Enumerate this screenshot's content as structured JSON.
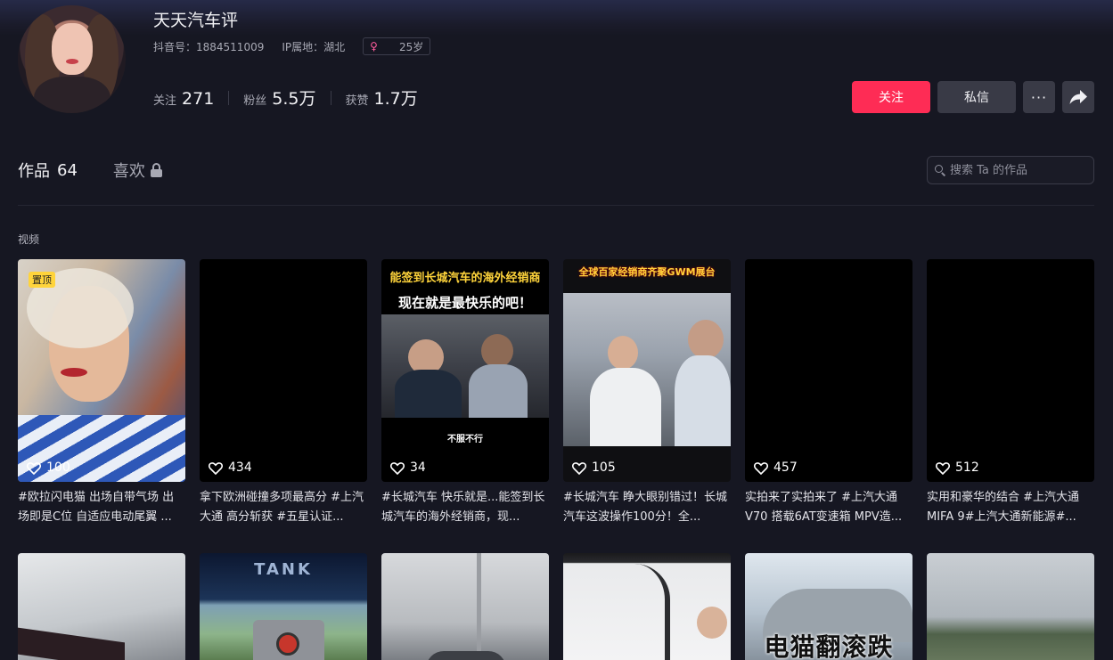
{
  "profile": {
    "name": "天天汽车评",
    "douyin_id": "抖音号：1884511009",
    "ip_location": "IP属地：湖北",
    "age": "25岁",
    "stats": [
      {
        "label": "关注",
        "value": "271"
      },
      {
        "label": "粉丝",
        "value": "5.5万"
      },
      {
        "label": "获赞",
        "value": "1.7万"
      }
    ]
  },
  "actions": {
    "follow": "关注",
    "message": "私信",
    "more": "···"
  },
  "tabs": {
    "works_label": "作品",
    "works_count": "64",
    "likes_label": "喜欢"
  },
  "search": {
    "placeholder": "搜索 Ta 的作品"
  },
  "section_label": "视频",
  "videos": [
    {
      "likes": "100",
      "pinned": "置顶",
      "caption": "#欧拉闪电猫 出场自带气场 出场即是C位 自适应电动尾翼 ..."
    },
    {
      "likes": "434",
      "caption": "拿下欧洲碰撞多项最高分 #上汽大通 高分斩获 #五星认证..."
    },
    {
      "likes": "34",
      "caption": "#长城汽车 快乐就是...能签到长城汽车的海外经销商，现...",
      "overlay_top": "能签到长城汽车的海外经销商",
      "overlay_mid": "现在就是最快乐的吧！",
      "overlay_bottom": "不服不行"
    },
    {
      "likes": "105",
      "caption": "#长城汽车 睁大眼别错过！长城汽车这波操作100分！全...",
      "overlay_top": "全球百家经销商齐聚GWM展台"
    },
    {
      "likes": "457",
      "caption": "实拍来了实拍来了 #上汽大通V70 搭载6AT变速箱 MPV造..."
    },
    {
      "likes": "512",
      "caption": "实用和豪华的结合 #上汽大通MIFA 9#上汽大通新能源#..."
    }
  ],
  "videos_row2": [
    {
      "overlay": ""
    },
    {
      "overlay": "TANK"
    },
    {
      "overlay": ""
    },
    {
      "overlay": ""
    },
    {
      "overlay": "电猫翻滚跌"
    },
    {
      "overlay": ""
    }
  ],
  "colors": {
    "background": "#161722",
    "accent": "#fe2c55",
    "button": "#393a46",
    "pin_badge": "#ffd43b"
  }
}
